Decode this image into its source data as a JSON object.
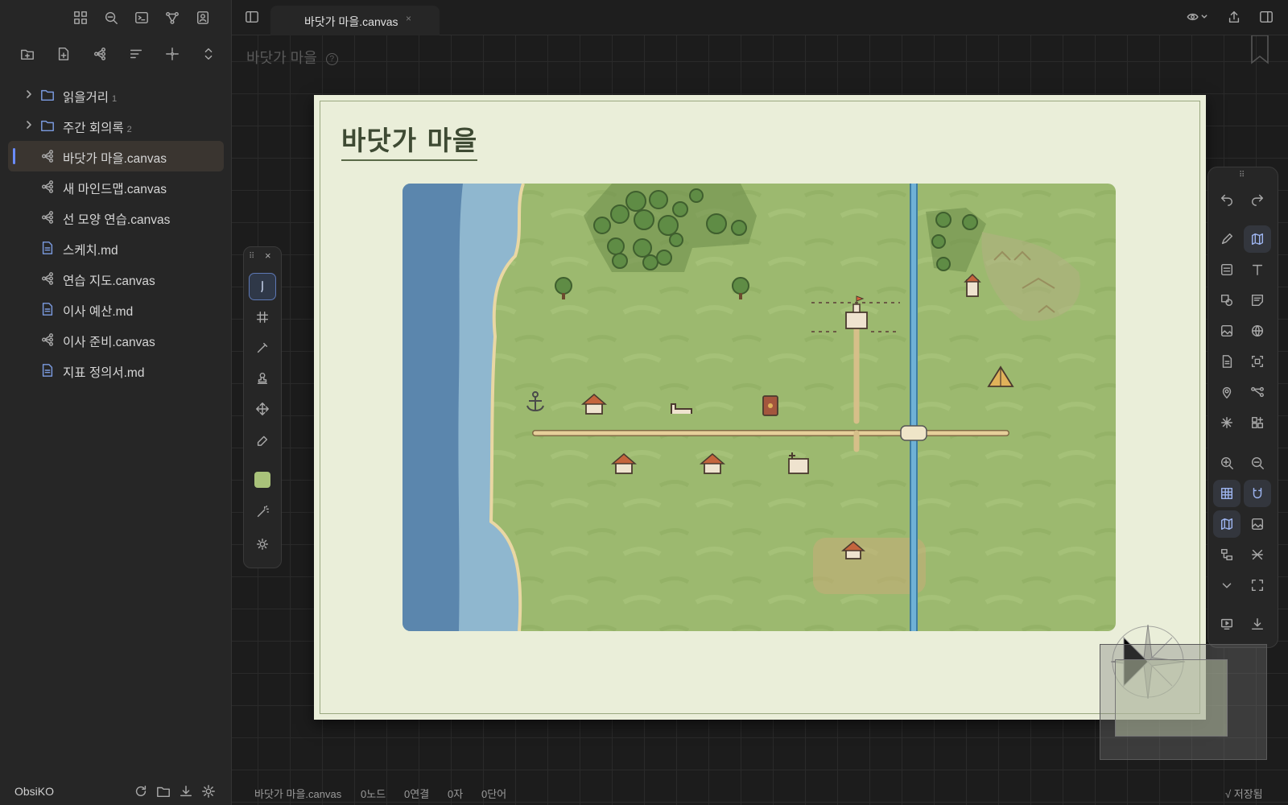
{
  "tab": {
    "title": "바닷가 마을.canvas",
    "close": "×"
  },
  "breadcrumb": {
    "title": "바닷가 마을",
    "help": "?"
  },
  "canvas": {
    "title": "바닷가 마을"
  },
  "sidebar": {
    "items": [
      {
        "type": "folder",
        "label": "읽을거리",
        "count": "1"
      },
      {
        "type": "folder",
        "label": "주간 회의록",
        "count": "2"
      },
      {
        "type": "canvas",
        "label": "바닷가 마을.canvas",
        "active": true
      },
      {
        "type": "canvas",
        "label": "새 마인드맵.canvas"
      },
      {
        "type": "canvas",
        "label": "선 모양 연습.canvas"
      },
      {
        "type": "md",
        "label": "스케치.md"
      },
      {
        "type": "canvas",
        "label": "연습 지도.canvas"
      },
      {
        "type": "md",
        "label": "이사 예산.md"
      },
      {
        "type": "canvas",
        "label": "이사 준비.canvas"
      },
      {
        "type": "md",
        "label": "지표 정의서.md"
      }
    ],
    "vault_name": "ObsiKO"
  },
  "status": {
    "file": "바닷가 마을.canvas",
    "nodes": "0노드",
    "links": "0연결",
    "chars": "0자",
    "words": "0단어",
    "saved": "√ 저장됨"
  },
  "colors": {
    "accent": "#6a8cff",
    "grass": "#9bb86d",
    "sea": "#5b86ad",
    "shallow": "#8fb7cf",
    "river": "#5aa0c8",
    "road": "#e2c98f",
    "card": "#eaeed9",
    "color_swatch": "#a9c27a"
  }
}
